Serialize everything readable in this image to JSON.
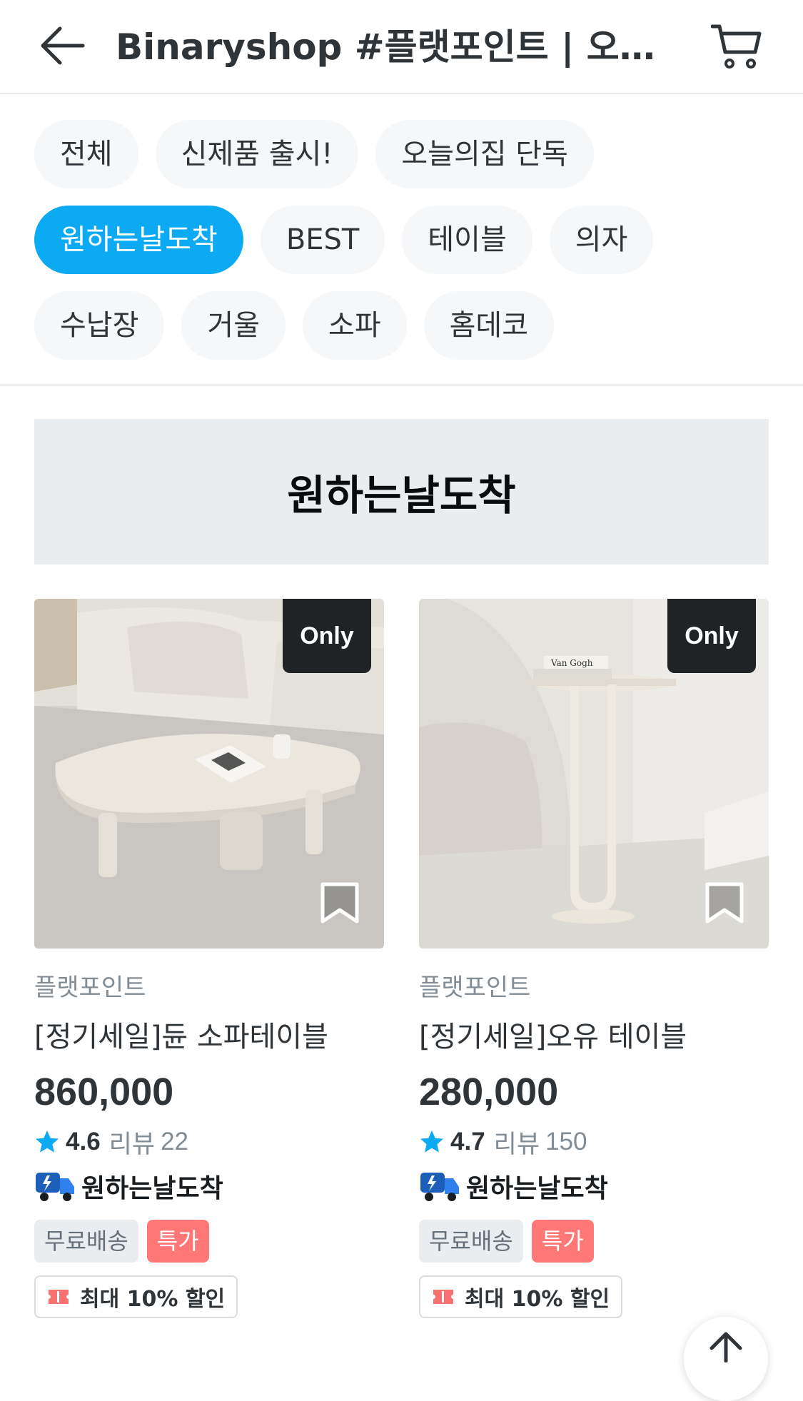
{
  "header": {
    "title": "Binaryshop #플랫포인트 | 오늘의집 스토어",
    "back_icon": "arrow-left-icon",
    "cart_icon": "cart-icon"
  },
  "chips": {
    "row1": [
      "전체",
      "신제품 출시!",
      "오늘의집 단독"
    ],
    "row2": [
      "원하는날도착",
      "BEST",
      "테이블",
      "의자"
    ],
    "row3": [
      "수납장",
      "거울",
      "소파",
      "홈데코"
    ],
    "active": "원하는날도착"
  },
  "section": {
    "title": "원하는날도착"
  },
  "products": [
    {
      "badge": "Only",
      "brand": "플랫포인트",
      "name": "[정기세일]듄 소파테이블",
      "price": "860,000",
      "rating": "4.6",
      "review_label": "리뷰",
      "review_count": "22",
      "delivery": "원하는날도착",
      "tags": [
        "무료배송",
        "특가"
      ],
      "coupon": "최대 10% 할인"
    },
    {
      "badge": "Only",
      "brand": "플랫포인트",
      "name": "[정기세일]오유 테이블",
      "price": "280,000",
      "rating": "4.7",
      "review_label": "리뷰",
      "review_count": "150",
      "delivery": "원하는날도착",
      "tags": [
        "무료배송",
        "특가"
      ],
      "coupon": "최대 10% 할인"
    }
  ],
  "colors": {
    "accent": "#0baaf2",
    "chip_bg": "#f5f7f8",
    "special_tag": "#ff7777",
    "coupon_icon": "#f77171"
  }
}
